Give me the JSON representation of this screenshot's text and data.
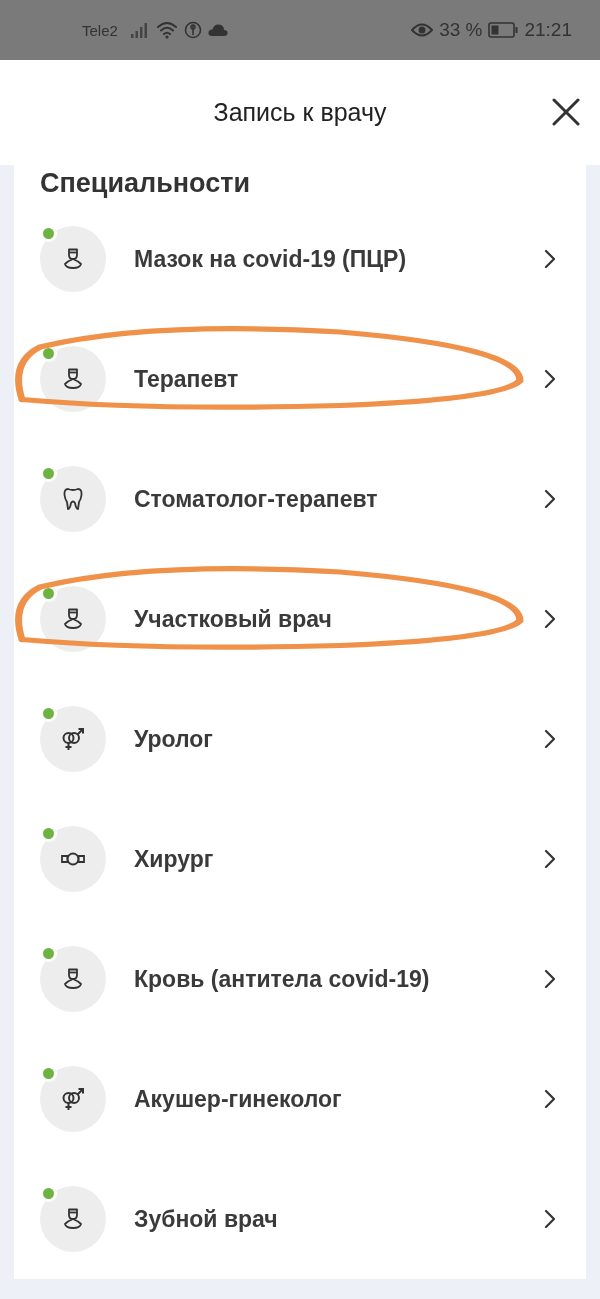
{
  "status_bar": {
    "carrier": "Tele2",
    "battery_percent": "33 %",
    "time": "21:21"
  },
  "header": {
    "title": "Запись к врачу"
  },
  "section": {
    "title": "Специальности"
  },
  "specialties": [
    {
      "label": "Мазок на covid-19 (ПЦР)",
      "kind": "doctor",
      "online": true,
      "circled": false
    },
    {
      "label": "Терапевт",
      "kind": "doctor",
      "online": true,
      "circled": true
    },
    {
      "label": "Стоматолог-терапевт",
      "kind": "tooth",
      "online": true,
      "circled": false
    },
    {
      "label": "Участковый врач",
      "kind": "doctor",
      "online": true,
      "circled": true
    },
    {
      "label": "Уролог",
      "kind": "gender",
      "online": true,
      "circled": false
    },
    {
      "label": "Хирург",
      "kind": "surgeon",
      "online": true,
      "circled": false
    },
    {
      "label": "Кровь (антитела covid-19)",
      "kind": "doctor",
      "online": true,
      "circled": false
    },
    {
      "label": "Акушер-гинеколог",
      "kind": "gender",
      "online": true,
      "circled": false
    },
    {
      "label": "Зубной врач",
      "kind": "doctor",
      "online": true,
      "circled": false
    }
  ]
}
